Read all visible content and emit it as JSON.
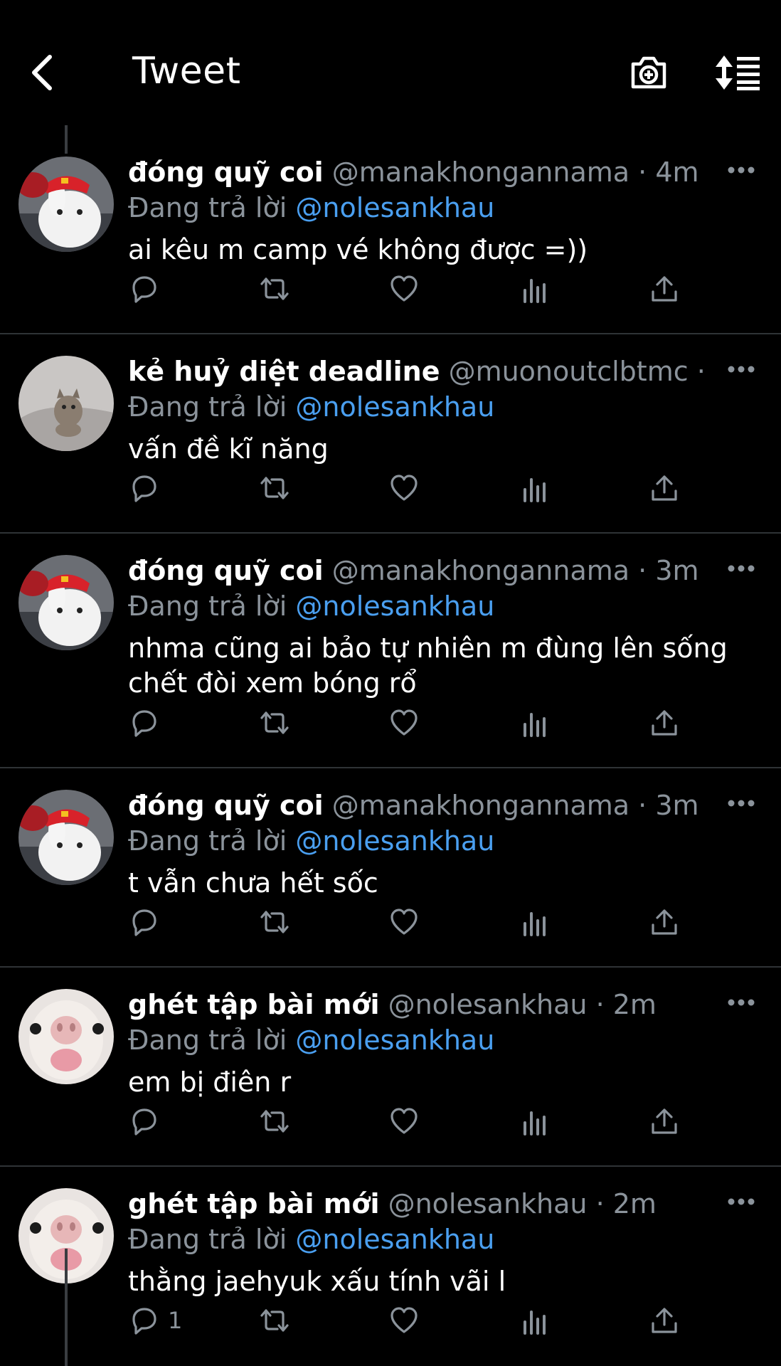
{
  "header": {
    "title": "Tweet",
    "back_icon": "chevron-left-icon",
    "camera_icon": "camera-plus-icon",
    "sort_icon": "sort-icon"
  },
  "colors": {
    "background": "#000000",
    "text": "#ffffff",
    "secondary": "#8b939b",
    "link": "#4a9ff0",
    "separator": "#2f3336"
  },
  "tweets": [
    {
      "name": "đóng quỹ coi",
      "handle": "@manakhongannama",
      "time": "· 4m",
      "reply_prefix": "Đang trả lời",
      "reply_handle": "@nolesankhau",
      "text": "ai kêu m camp vé không được =))",
      "reply_count": ""
    },
    {
      "name": "kẻ huỷ diệt deadline",
      "handle": "@muonoutclbtmc",
      "time": "· ...",
      "reply_prefix": "Đang trả lời",
      "reply_handle": "@nolesankhau",
      "text": "vấn đề kĩ năng",
      "reply_count": ""
    },
    {
      "name": "đóng quỹ coi",
      "handle": "@manakhongannama",
      "time": "· 3m",
      "reply_prefix": "Đang trả lời",
      "reply_handle": "@nolesankhau",
      "text": "nhma cũng ai bảo tự nhiên m đùng lên sống chết đòi xem bóng rổ",
      "reply_count": ""
    },
    {
      "name": "đóng quỹ coi",
      "handle": "@manakhongannama",
      "time": "· 3m",
      "reply_prefix": "Đang trả lời",
      "reply_handle": "@nolesankhau",
      "text": "t vẫn chưa hết sốc",
      "reply_count": ""
    },
    {
      "name": "ghét tập bài mới",
      "handle": "@nolesankhau",
      "time": "· 2m",
      "reply_prefix": "Đang trả lời",
      "reply_handle": "@nolesankhau",
      "text": "em bị điên r",
      "reply_count": ""
    },
    {
      "name": "ghét tập bài mới",
      "handle": "@nolesankhau",
      "time": "· 2m",
      "reply_prefix": "Đang trả lời",
      "reply_handle": "@nolesankhau",
      "text": "thằng jaehyuk xấu tính vãi l",
      "reply_count": "1"
    }
  ]
}
